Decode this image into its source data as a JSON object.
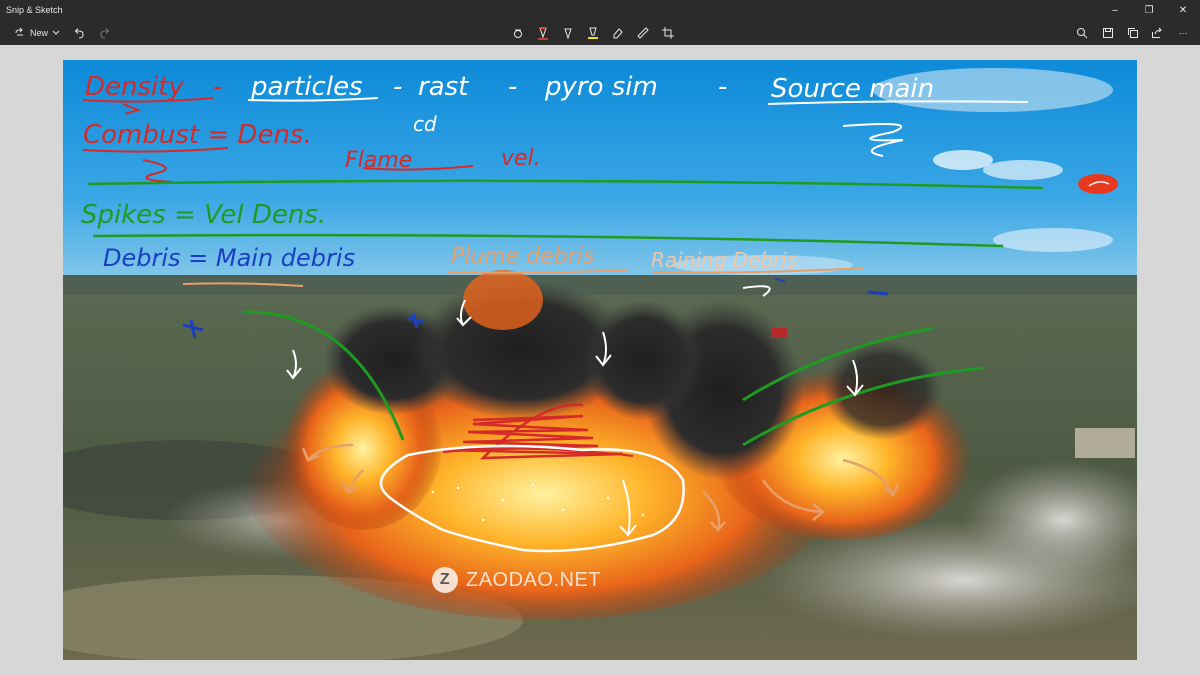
{
  "window": {
    "title": "Snip & Sketch",
    "minimize": "–",
    "maximize": "❐",
    "close": "✕"
  },
  "toolbar": {
    "new_label": "New",
    "more_label": "···"
  },
  "annotations": {
    "line1": [
      "Density",
      "particles",
      "rast",
      "pyro sim",
      "Source main"
    ],
    "cd": "cd",
    "line2_a": "Combust = Dens.",
    "line2_b": "Flame",
    "line2_c": "vel.",
    "line3": "Spikes = Vel Dens.",
    "line4_a": "Debris = Main debris",
    "line4_b": "Plume debris",
    "line4_c": "Raining Debris"
  },
  "watermark": {
    "logo": "Z",
    "text": "ZAODAO.NET"
  },
  "colors": {
    "ink_red": "#d42a2a",
    "ink_green": "#1f9a22",
    "ink_blue": "#1a3fc0",
    "ink_orange": "#e8a06a",
    "ink_white": "#ffffff",
    "highlight_red": "#e8391e"
  }
}
